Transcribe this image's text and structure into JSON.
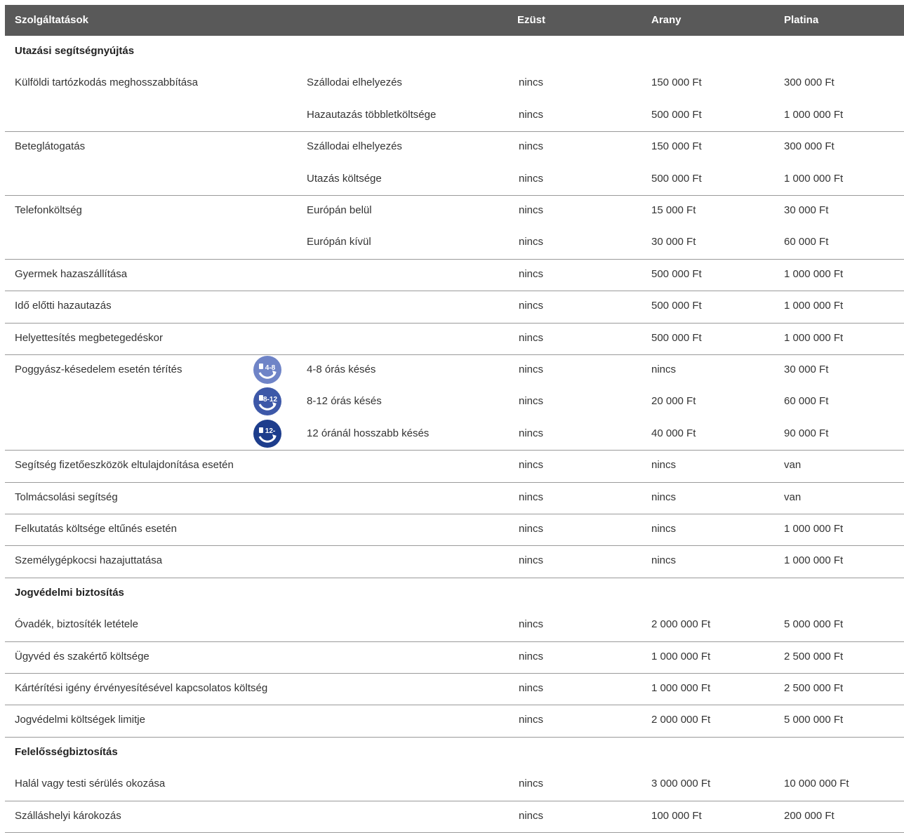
{
  "header": {
    "services": "Szolgáltatások",
    "silver": "Ezüst",
    "gold": "Arany",
    "platinum": "Platina"
  },
  "rows": [
    {
      "type": "section",
      "label": "Utazási segítségnyújtás"
    },
    {
      "type": "item",
      "main": "Külföldi tartózkodás meghosszabbítása",
      "sub": "Szállodai elhelyezés",
      "silver": "nincs",
      "gold": "150 000 Ft",
      "platinum": "300 000 Ft"
    },
    {
      "type": "item",
      "main": "",
      "sub": "Hazautazás többletköltsége",
      "silver": "nincs",
      "gold": "500 000 Ft",
      "platinum": "1 000 000 Ft"
    },
    {
      "type": "item",
      "main": "Beteglátogatás",
      "sub": "Szállodai elhelyezés",
      "silver": "nincs",
      "gold": "150 000 Ft",
      "platinum": "300 000 Ft"
    },
    {
      "type": "item",
      "main": "",
      "sub": "Utazás költsége",
      "silver": "nincs",
      "gold": "500 000 Ft",
      "platinum": "1 000 000 Ft"
    },
    {
      "type": "item",
      "main": "Telefonköltség",
      "sub": "Európán belül",
      "silver": "nincs",
      "gold": "15 000 Ft",
      "platinum": "30 000 Ft"
    },
    {
      "type": "item",
      "main": "",
      "sub": "Európán kívül",
      "silver": "nincs",
      "gold": "30 000 Ft",
      "platinum": "60 000 Ft"
    },
    {
      "type": "item",
      "main": "Gyermek hazaszállítása",
      "sub": "",
      "silver": "nincs",
      "gold": "500 000 Ft",
      "platinum": "1 000 000 Ft"
    },
    {
      "type": "item",
      "main": "Idő előtti hazautazás",
      "sub": "",
      "silver": "nincs",
      "gold": "500 000 Ft",
      "platinum": "1 000 000 Ft"
    },
    {
      "type": "item",
      "main": "Helyettesítés megbetegedéskor",
      "sub": "",
      "silver": "nincs",
      "gold": "500 000 Ft",
      "platinum": "1 000 000 Ft"
    },
    {
      "type": "item",
      "main": "Poggyász-késedelem esetén térítés",
      "sub": "4-8 órás késés",
      "silver": "nincs",
      "gold": "nincs",
      "platinum": "30 000 Ft",
      "icon": {
        "name": "luggage-delay-4-8-icon",
        "label": "4-8",
        "color": "#6f84c7"
      }
    },
    {
      "type": "item",
      "main": "",
      "sub": "8-12 órás késés",
      "silver": "nincs",
      "gold": "20 000 Ft",
      "platinum": "60 000 Ft",
      "icon": {
        "name": "luggage-delay-8-12-icon",
        "label": "8-12",
        "color": "#3d58a8"
      }
    },
    {
      "type": "item",
      "main": "",
      "sub": "12 óránál hosszabb késés",
      "silver": "nincs",
      "gold": "40 000 Ft",
      "platinum": "90 000 Ft",
      "icon": {
        "name": "luggage-delay-12-plus-icon",
        "label": "12-",
        "color": "#1d3d8c"
      }
    },
    {
      "type": "item",
      "main": "Segítség fizetőeszközök eltulajdonítása esetén",
      "sub": "",
      "silver": "nincs",
      "gold": "nincs",
      "platinum": "van"
    },
    {
      "type": "item",
      "main": "Tolmácsolási segítség",
      "sub": "",
      "silver": "nincs",
      "gold": "nincs",
      "platinum": "van"
    },
    {
      "type": "item",
      "main": "Felkutatás költsége eltűnés esetén",
      "sub": "",
      "silver": "nincs",
      "gold": "nincs",
      "platinum": "1 000 000 Ft"
    },
    {
      "type": "item",
      "main": "Személygépkocsi hazajuttatása",
      "sub": "",
      "silver": "nincs",
      "gold": "nincs",
      "platinum": "1 000 000 Ft"
    },
    {
      "type": "section",
      "label": "Jogvédelmi biztosítás"
    },
    {
      "type": "item",
      "main": "Óvadék, biztosíték letétele",
      "sub": "",
      "silver": "nincs",
      "gold": "2 000 000 Ft",
      "platinum": "5 000 000 Ft"
    },
    {
      "type": "item",
      "main": "Ügyvéd és szakértő költsége",
      "sub": "",
      "silver": "nincs",
      "gold": "1 000 000 Ft",
      "platinum": "2 500 000 Ft"
    },
    {
      "type": "item",
      "main": "Kártérítési igény érvényesítésével kapcsolatos költség",
      "sub": "",
      "silver": "nincs",
      "gold": "1 000 000 Ft",
      "platinum": "2 500 000 Ft"
    },
    {
      "type": "item",
      "main": "Jogvédelmi költségek limitje",
      "sub": "",
      "silver": "nincs",
      "gold": "2 000 000 Ft",
      "platinum": "5 000 000 Ft"
    },
    {
      "type": "section",
      "label": "Felelősségbiztosítás"
    },
    {
      "type": "item",
      "main": "Halál vagy testi sérülés okozása",
      "sub": "",
      "silver": "nincs",
      "gold": "3 000 000 Ft",
      "platinum": "10 000 000 Ft"
    },
    {
      "type": "item",
      "main": "Szálláshelyi károkozás",
      "sub": "",
      "silver": "nincs",
      "gold": "100 000 Ft",
      "platinum": "200 000 Ft"
    }
  ]
}
